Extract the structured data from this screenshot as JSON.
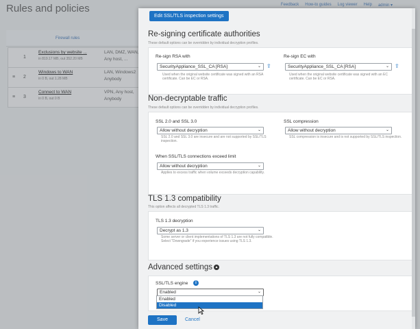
{
  "background": {
    "title": "Rules and policies",
    "top_links": [
      "Feedback",
      "How-to guides",
      "Log viewer",
      "Help",
      "admin ▾"
    ],
    "tab": "Firewall rules",
    "rules": [
      {
        "num": "1",
        "name": "Exclusions by website ...",
        "meta": "in 819.17 MB, out 352.20 MB",
        "col1": "LAN, DMZ, WAN,",
        "col2": "Any host, ..."
      },
      {
        "num": "2",
        "name": "Windows to WAN",
        "meta": "in 0 B, out 1.28 MB",
        "col1": "LAN, Windows2",
        "col2": "Anybody"
      },
      {
        "num": "3",
        "name": "Connect to WAN",
        "meta": "in 0 B, out 0 B",
        "col1": "VPN, Any host,",
        "col2": "Anybody"
      }
    ]
  },
  "dialog": {
    "header": "Edit SSL/TLS inspection settings",
    "resign": {
      "title": "Re-signing certificate authorities",
      "subtitle": "These default options can be overridden by individual decryption profiles.",
      "rsa_label": "Re-sign RSA with",
      "rsa_value": "SecurityAppliance_SSL_CA [RSA]",
      "rsa_help": "Used when the original website certificate was signed with an RSA certificate. Can be EC or RSA.",
      "ec_label": "Re-sign EC with",
      "ec_value": "SecurityAppliance_SSL_CA [RSA]",
      "ec_help": "Used when the original website certificate was signed with an EC certificate. Can be EC or RSA."
    },
    "nondecrypt": {
      "title": "Non-decryptable traffic",
      "subtitle": "These default options can be overridden by individual decryption profiles.",
      "ssl2_label": "SSL 2.0 and SSL 3.0",
      "ssl2_value": "Allow without decryption",
      "ssl2_help": "SSL 2.0 and SSL 3.0 are insecure and are not supported by SSL/TLS inspection.",
      "comp_label": "SSL compression",
      "comp_value": "Allow without decryption",
      "comp_help": "SSL compression is insecure and is not supported by SSL/TLS inspection.",
      "limit_label": "When SSL/TLS connections exceed limit",
      "limit_value": "Allow without decryption",
      "limit_help": "Applies to excess traffic when volume exceeds decryption capability."
    },
    "tls13": {
      "title": "TLS 1.3 compatibility",
      "subtitle": "This option affects all decrypted TLS 1.3 traffic.",
      "label": "TLS 1.3 decryption",
      "value": "Decrypt as 1.3",
      "help": "Some server or client implementations of TLS 1.3 are not fully compatible. Select \"Downgrade\" if you experience issues using TLS 1.3."
    },
    "advanced": {
      "title": "Advanced settings",
      "engine_label": "SSL/TLS engine",
      "engine_value": "Enabled",
      "options": [
        "Enabled",
        "Disabled"
      ],
      "highlighted_option": "Disabled"
    },
    "save_label": "Save",
    "cancel_label": "Cancel"
  },
  "colors": {
    "accent": "#1e73c4"
  }
}
